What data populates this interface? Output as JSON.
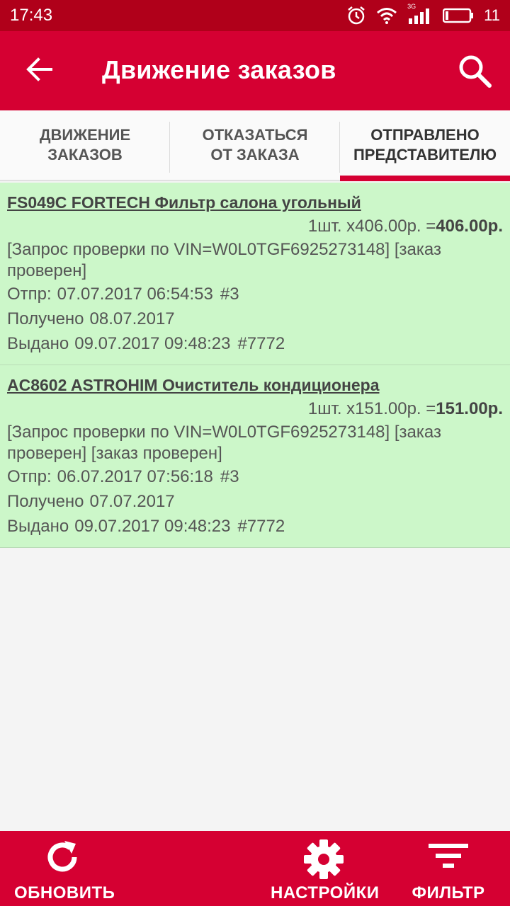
{
  "status": {
    "time": "17:43",
    "network": "3G",
    "battery": "11"
  },
  "appbar": {
    "title": "Движение заказов"
  },
  "tabs": [
    {
      "label": "ДВИЖЕНИЕ\nЗАКАЗОВ"
    },
    {
      "label": "ОТКАЗАТЬСЯ\nОТ ЗАКАЗА"
    },
    {
      "label": "ОТПРАВЛЕНО\nПРЕДСТАВИТЕЛЮ"
    }
  ],
  "orders": [
    {
      "name": "FS049C FORTECH Фильтр салона угольный ",
      "qty_price": "1шт. x406.00р. =",
      "total": "406.00р.",
      "note": "[Запрос проверки по VIN=W0L0TGF6925273148] [заказ проверен]",
      "sent_label": "Отпр:",
      "sent_value": "07.07.2017 06:54:53",
      "sent_num": "#3",
      "received_label": "Получено",
      "received_value": "08.07.2017",
      "issued_label": "Выдано",
      "issued_value": "09.07.2017 09:48:23",
      "issued_num": "#7772"
    },
    {
      "name": "AC8602 ASTROHIM Очиститель кондиционера ",
      "qty_price": "1шт. x151.00р. =",
      "total": "151.00р.",
      "note": "[Запрос проверки по VIN=W0L0TGF6925273148] [заказ проверен] [заказ проверен]",
      "sent_label": "Отпр:",
      "sent_value": "06.07.2017 07:56:18",
      "sent_num": "#3",
      "received_label": "Получено",
      "received_value": "07.07.2017",
      "issued_label": "Выдано",
      "issued_value": "09.07.2017 09:48:23",
      "issued_num": "#7772"
    }
  ],
  "bottombar": {
    "refresh_label": "ОБНОВИТЬ",
    "settings_label": "НАСТРОЙКИ",
    "filter_label": "ФИЛЬТР"
  },
  "colors": {
    "primary": "#d50032",
    "statusbar": "#b0001a",
    "card_bg": "#ccf7c9"
  }
}
